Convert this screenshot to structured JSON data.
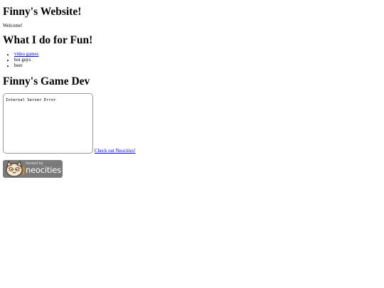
{
  "header": {
    "title": "Finny's Website!",
    "welcome": "Welcome!"
  },
  "fun": {
    "heading": "What I do for Fun!",
    "items": [
      {
        "label": "video games",
        "is_link": true
      },
      {
        "label": "hot guys",
        "is_link": false
      },
      {
        "label": "beer",
        "is_link": false
      }
    ]
  },
  "gamedev": {
    "heading": "Finny's Game Dev",
    "iframe_text": "Internal Server Error",
    "link_label": "Check out Neocities!"
  },
  "badge": {
    "small_text": "hosted by",
    "big_text": "neocities",
    "icon": "neocities-cat-icon",
    "color": "#7a7a7a"
  },
  "colors": {
    "link": "#0000ee",
    "text": "#000000",
    "background": "#ffffff"
  }
}
